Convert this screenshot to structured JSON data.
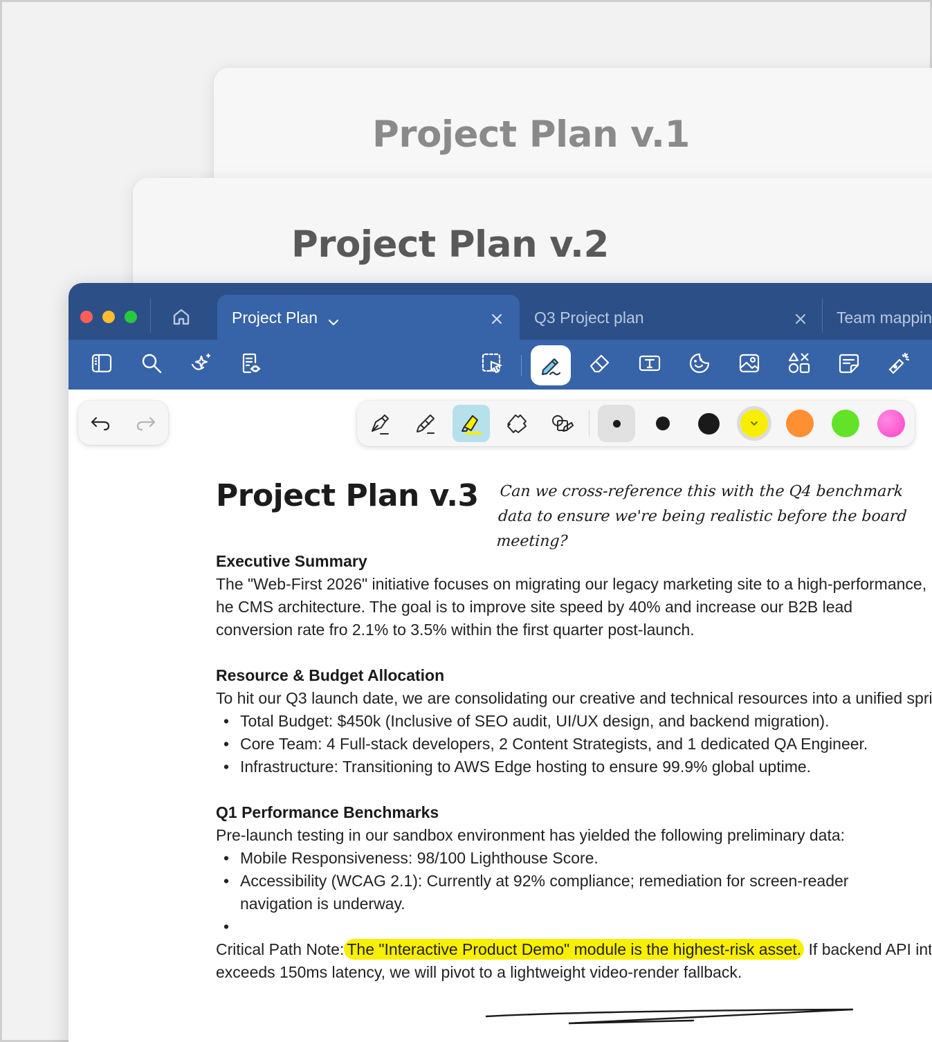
{
  "background_docs": [
    {
      "title": "Project Plan v.1"
    },
    {
      "title": "Project Plan v.2"
    }
  ],
  "tabs": [
    {
      "label": "Project Plan",
      "active": true
    },
    {
      "label": "Q3 Project plan",
      "active": false
    },
    {
      "label": "Team mappin",
      "active": false
    }
  ],
  "toolbar": {
    "left_tools": [
      "sidebar-icon",
      "search-icon",
      "ai-sparkle-icon",
      "document-review-icon"
    ],
    "right_tools": [
      "lasso-select-icon",
      "pen-icon",
      "eraser-icon",
      "text-box-icon",
      "sticker-icon",
      "image-icon",
      "shapes-icon",
      "sticky-note-icon",
      "laser-pointer-icon"
    ],
    "selected_tool": "pen-icon"
  },
  "pen_tools": {
    "types": [
      "fountain-pen-icon",
      "brush-pen-icon",
      "highlighter-icon",
      "tape-icon",
      "shape-pen-icon"
    ],
    "selected_type": "highlighter-icon",
    "sizes": [
      "small",
      "medium",
      "large"
    ],
    "selected_size": "small",
    "colors": [
      "#f8ef00",
      "#ff8f33",
      "#63e327",
      "#ff4fcf"
    ],
    "selected_color": "#f8ef00"
  },
  "document": {
    "title": "Project Plan v.3",
    "annotation": "Can we cross-reference this with the Q4 benchmark data to ensure we're being realistic before the board meeting?",
    "sections": {
      "exec_heading": "Executive Summary",
      "exec_text": "The \"Web-First 2026\" initiative focuses on migrating our legacy marketing site to a high-performance, he CMS architecture. The goal is to improve site speed by 40% and increase our B2B lead conversion rate fro 2.1% to 3.5% within the first quarter post-launch.",
      "budget_heading": "Resource & Budget Allocation",
      "budget_intro": "To hit our Q3 launch date, we are consolidating our creative and technical resources into a unified sprint c",
      "budget_items": [
        "Total Budget: $450k (Inclusive of SEO audit, UI/UX design, and backend migration).",
        "Core Team: 4 Full-stack developers, 2 Content Strategists, and 1 dedicated QA Engineer.",
        "Infrastructure: Transitioning to AWS Edge hosting to ensure 99.9% global uptime."
      ],
      "bench_heading": "Q1 Performance Benchmarks",
      "bench_intro": "Pre-launch testing in our sandbox environment has yielded the following preliminary data:",
      "bench_items": [
        "Mobile Responsiveness: 98/100 Lighthouse Score.",
        "Accessibility (WCAG 2.1): Currently at 92% compliance; remediation for screen-reader navigation is underway.",
        ""
      ],
      "note_prefix": "Critical Path Note:",
      "note_highlight": "The \"Interactive Product Demo\" module is the highest-risk asset.",
      "note_line1_rest": "If backend API integr",
      "note_line2": "exceeds 150ms latency, we will pivot to a lightweight video-render fallback."
    }
  }
}
